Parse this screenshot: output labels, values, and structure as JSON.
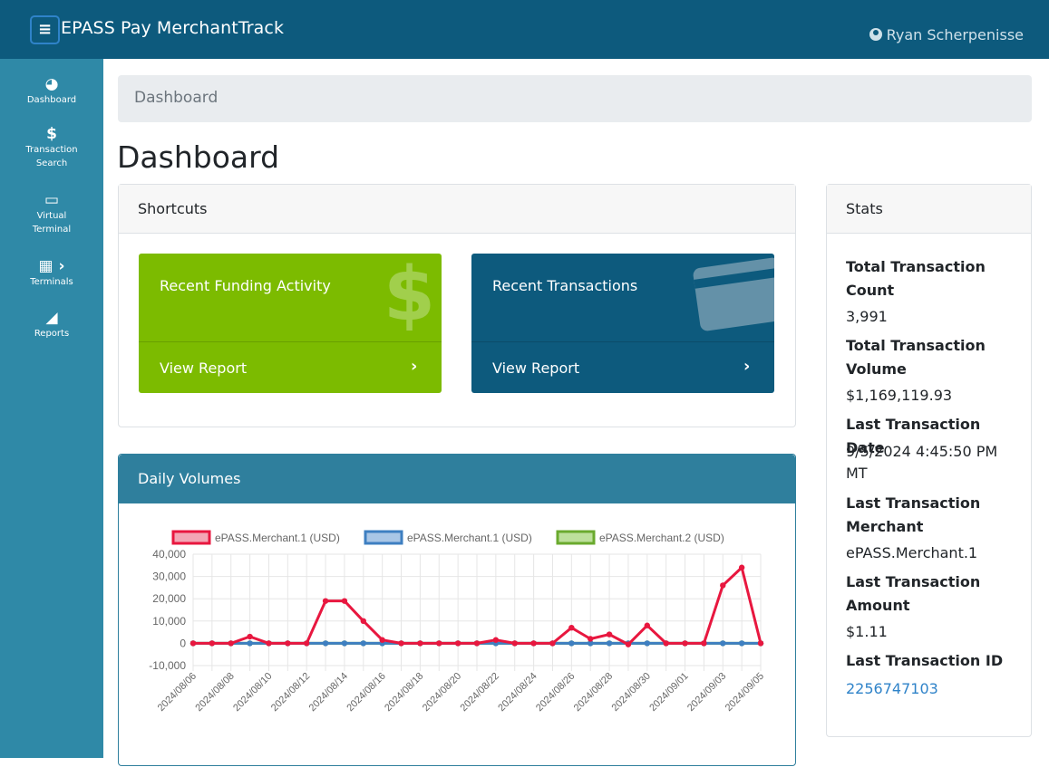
{
  "header": {
    "menu_icon": "hamburger-icon",
    "brand": "EPASS Pay MerchantTrack",
    "user_name": "Ryan Scherpenisse"
  },
  "sidebar": {
    "items": [
      {
        "icon": "dashboard-icon",
        "glyph": "◕",
        "label": "Dashboard"
      },
      {
        "icon": "dollar-icon",
        "glyph": "$",
        "label": "Transaction Search"
      },
      {
        "icon": "monitor-icon",
        "glyph": "▭",
        "label": "Virtual Terminal"
      },
      {
        "icon": "calculator-icon",
        "glyph": "▦ ›",
        "label": "Terminals"
      },
      {
        "icon": "area-chart-icon",
        "glyph": "◢",
        "label": "Reports"
      }
    ]
  },
  "breadcrumb": {
    "current": "Dashboard"
  },
  "page_title": "Dashboard",
  "shortcuts": {
    "title": "Shortcuts",
    "cards": [
      {
        "label": "Recent Funding Activity",
        "action": "View Report",
        "icon": "dollar-icon",
        "color": "#7cbb00"
      },
      {
        "label": "Recent Transactions",
        "action": "View Report",
        "icon": "credit-card-icon",
        "color": "#0d5a7d"
      }
    ]
  },
  "daily_volumes": {
    "title": "Daily Volumes"
  },
  "stats": {
    "title": "Stats",
    "total_count_label": "Total Transaction Count",
    "total_count": "3,991",
    "total_volume_label": "Total Transaction Volume",
    "total_volume": "$1,169,119.93",
    "last_date_label": "Last Transaction Date",
    "last_date": "9/5/2024 4:45:50 PM MT",
    "last_merchant_label": "Last Transaction Merchant",
    "last_merchant": "ePASS.Merchant.1",
    "last_amount_label": "Last Transaction Amount",
    "last_amount": "$1.11",
    "last_id_label": "Last Transaction ID",
    "last_id": "2256747103"
  },
  "chart_data": {
    "type": "line",
    "x": [
      "2024/08/06",
      "2024/08/07",
      "2024/08/08",
      "2024/08/09",
      "2024/08/10",
      "2024/08/11",
      "2024/08/12",
      "2024/08/13",
      "2024/08/14",
      "2024/08/15",
      "2024/08/16",
      "2024/08/17",
      "2024/08/18",
      "2024/08/19",
      "2024/08/20",
      "2024/08/21",
      "2024/08/22",
      "2024/08/23",
      "2024/08/24",
      "2024/08/25",
      "2024/08/26",
      "2024/08/27",
      "2024/08/28",
      "2024/08/29",
      "2024/08/30",
      "2024/08/31",
      "2024/09/01",
      "2024/09/02",
      "2024/09/03",
      "2024/09/04",
      "2024/09/05"
    ],
    "x_tick_labels": [
      "2024/08/06",
      "2024/08/08",
      "2024/08/10",
      "2024/08/12",
      "2024/08/14",
      "2024/08/16",
      "2024/08/18",
      "2024/08/20",
      "2024/08/22",
      "2024/08/24",
      "2024/08/26",
      "2024/08/28",
      "2024/08/30",
      "2024/09/01",
      "2024/09/03",
      "2024/09/05"
    ],
    "ylim": [
      -10000,
      40000
    ],
    "y_ticks": [
      40000,
      30000,
      20000,
      10000,
      0,
      -10000
    ],
    "y_tick_labels": [
      "40,000",
      "30,000",
      "20,000",
      "10,000",
      "0",
      "-10,000"
    ],
    "grid": true,
    "legend_position": "top",
    "series": [
      {
        "name": "ePASS.Merchant.1 (USD)",
        "color": "#e8173f",
        "fill": "#f3a6b5",
        "values": [
          0,
          0,
          0,
          3000,
          0,
          0,
          0,
          19000,
          19000,
          10000,
          1500,
          0,
          0,
          0,
          0,
          0,
          1500,
          0,
          0,
          0,
          7000,
          2000,
          4000,
          -500,
          8000,
          0,
          0,
          0,
          26000,
          34000,
          0
        ]
      },
      {
        "name": "ePASS.Merchant.1 (USD)",
        "color": "#3e7fc1",
        "fill": "#a9c6e6",
        "values": [
          0,
          0,
          0,
          0,
          0,
          0,
          0,
          0,
          0,
          0,
          0,
          0,
          0,
          0,
          0,
          0,
          0,
          0,
          0,
          0,
          0,
          0,
          0,
          0,
          0,
          0,
          0,
          0,
          0,
          0,
          0
        ]
      },
      {
        "name": "ePASS.Merchant.2 (USD)",
        "color": "#6aaa2e",
        "fill": "#bde09c",
        "values": [
          0,
          0,
          0,
          0,
          0,
          0,
          0,
          0,
          0,
          0,
          0,
          0,
          0,
          0,
          0,
          0,
          0,
          0,
          0,
          0,
          0,
          0,
          0,
          0,
          0,
          0,
          0,
          0,
          0,
          0,
          0
        ]
      }
    ]
  }
}
